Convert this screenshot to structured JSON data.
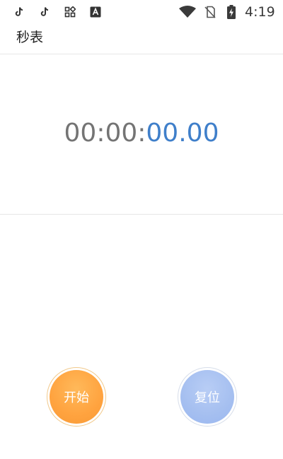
{
  "status_bar": {
    "time": "4:19",
    "icons": [
      "tiktok-icon",
      "tiktok-icon",
      "apps-grid-icon",
      "font-a-icon",
      "wifi-icon",
      "no-sim-icon",
      "battery-charging-icon"
    ]
  },
  "header": {
    "title": "秒表"
  },
  "stopwatch": {
    "time_main": "00:00:",
    "time_ms": "00.00"
  },
  "controls": {
    "start_label": "开始",
    "reset_label": "复位"
  },
  "colors": {
    "start_button": "#ffa33f",
    "reset_button": "#a5bff0",
    "ms_text": "#3f7fca",
    "main_text": "#747474"
  }
}
